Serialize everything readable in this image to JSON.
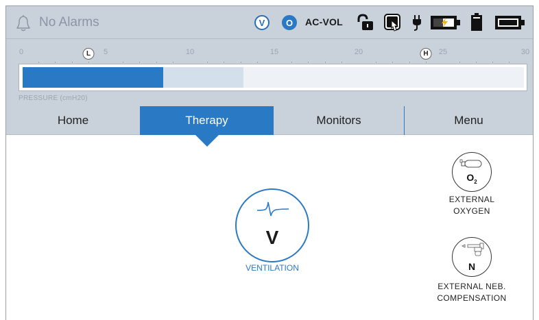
{
  "status": {
    "alarm_text": "No Alarms",
    "badge_v": "V",
    "badge_o": "O",
    "mode": "AC-VOL"
  },
  "pressure": {
    "label": "PRESSURE (cmH20)",
    "scale": {
      "min": 0,
      "max": 30,
      "major_ticks": [
        "0",
        "5",
        "10",
        "15",
        "20",
        "25",
        "30"
      ]
    },
    "low_marker": "L",
    "high_marker": "H",
    "current_value_fraction": 0.28,
    "peak_value_fraction": 0.44
  },
  "tabs": [
    {
      "label": "Home"
    },
    {
      "label": "Therapy"
    },
    {
      "label": "Monitors"
    },
    {
      "label": "Menu"
    }
  ],
  "active_tab": "Therapy",
  "content": {
    "ventilation": {
      "letter": "V",
      "label": "VENTILATION"
    },
    "external_oxygen": {
      "symbol": "O",
      "subscript": "2",
      "label_line1": "EXTERNAL",
      "label_line2": "OXYGEN"
    },
    "external_neb": {
      "symbol": "N",
      "label_line1": "EXTERNAL NEB.",
      "label_line2": "COMPENSATION"
    }
  },
  "colors": {
    "accent": "#2a79c4",
    "bar_bg": "#c9d1da"
  },
  "icons": [
    "bell-icon",
    "unlock-icon",
    "touch-lock-icon",
    "ac-plug-icon",
    "battery-charging-icon",
    "battery-internal-icon",
    "battery-full-icon",
    "ventilation-waveform-icon",
    "oxygen-cylinder-icon",
    "nebulizer-icon"
  ]
}
